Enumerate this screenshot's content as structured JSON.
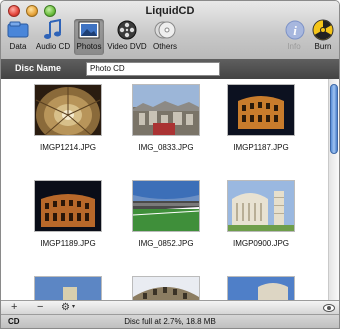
{
  "window": {
    "title": "LiquidCD"
  },
  "toolbar": {
    "items": [
      {
        "label": "Data",
        "icon": "data-disc-icon"
      },
      {
        "label": "Audio CD",
        "icon": "music-note-icon"
      },
      {
        "label": "Photos",
        "icon": "photos-icon",
        "selected": true
      },
      {
        "label": "Video DVD",
        "icon": "film-reel-icon"
      },
      {
        "label": "Others",
        "icon": "disc-stack-icon"
      },
      {
        "label": "Info",
        "icon": "info-icon",
        "disabled": true
      },
      {
        "label": "Burn",
        "icon": "burn-icon"
      }
    ]
  },
  "disc": {
    "label": "Disc Name",
    "value": "Photo CD"
  },
  "photos": [
    {
      "name": "IMGP1214.JPG"
    },
    {
      "name": "IMG_0833.JPG"
    },
    {
      "name": "IMGP1187.JPG"
    },
    {
      "name": "IMGP1189.JPG"
    },
    {
      "name": "IMG_0852.JPG"
    },
    {
      "name": "IMGP0900.JPG"
    }
  ],
  "actions": {
    "add": "+",
    "remove": "−",
    "gear": "⚙"
  },
  "status": {
    "left": "CD",
    "text": "Disc full at 2.7%, 18.8 MB"
  },
  "colors": {
    "selected_tab": "#8f8f8f",
    "burn_yellow": "#f5c518",
    "info_blue": "#5a79c9"
  }
}
